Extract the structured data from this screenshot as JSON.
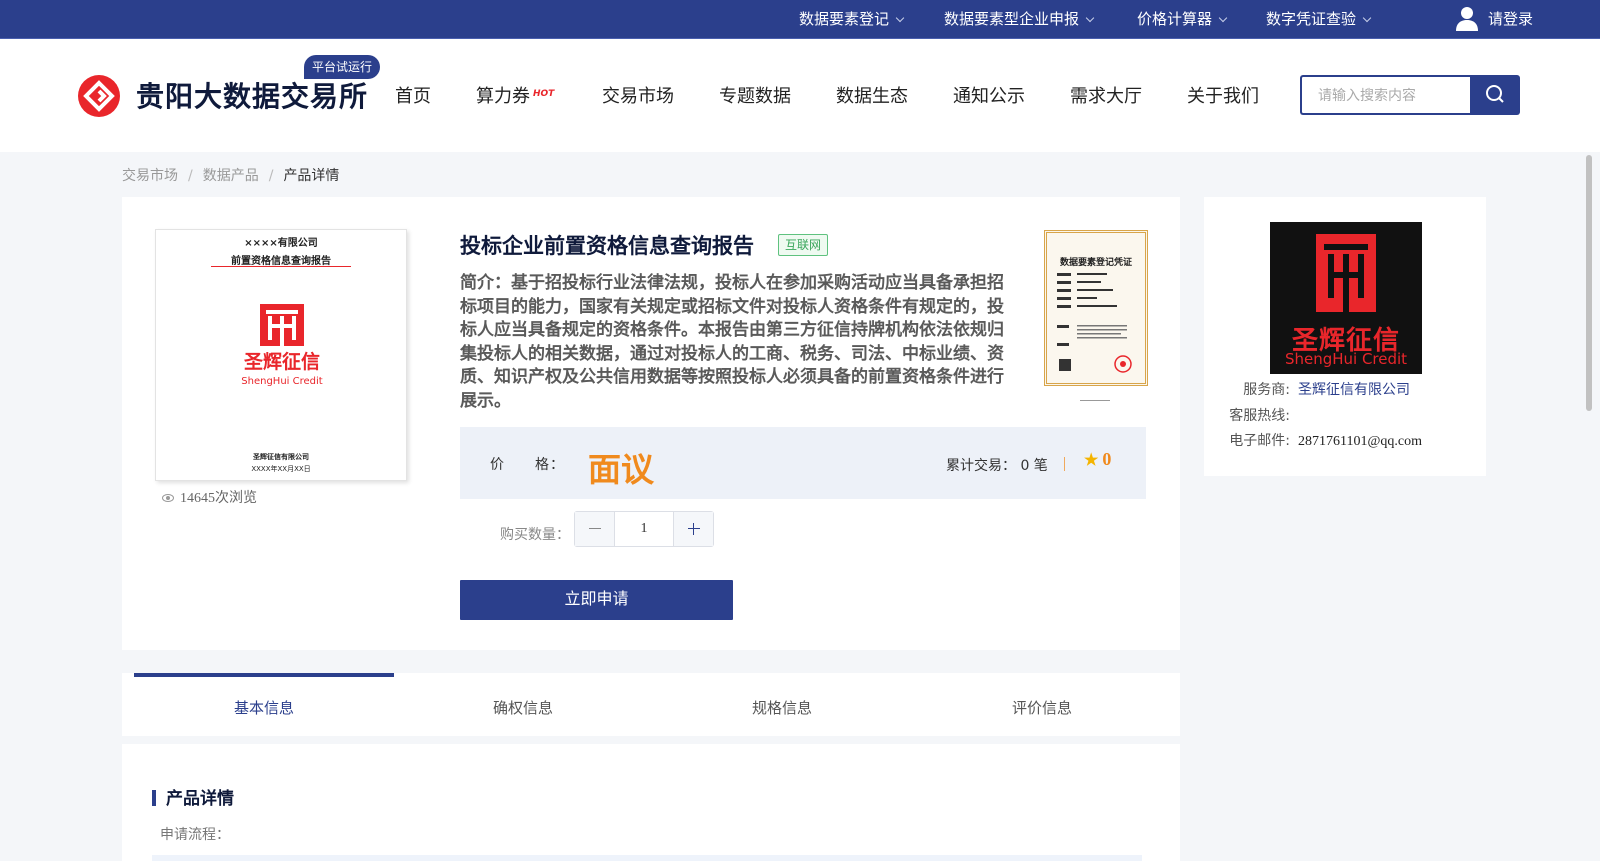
{
  "topbar": {
    "items": [
      "数据要素登记",
      "数据要素型企业申报",
      "价格计算器",
      "数字凭证查验"
    ],
    "login": "请登录"
  },
  "header": {
    "logo_text": "贵阳大数据交易所",
    "trial_badge": "平台试运行",
    "nav": [
      "首页",
      "算力券",
      "交易市场",
      "专题数据",
      "数据生态",
      "通知公示",
      "需求大厅",
      "关于我们"
    ],
    "hot_badge": "HOT",
    "search_placeholder": "请输入搜索内容"
  },
  "breadcrumb": [
    "交易市场",
    "数据产品",
    "产品详情"
  ],
  "product": {
    "cover": {
      "company": "××××有限公司",
      "report_title": "前置资格信息查询报告",
      "brand_cn": "圣辉征信",
      "brand_en": "ShengHui Credit",
      "footer_company": "圣辉征信有限公司",
      "footer_date": "XXXX年XX月XX日"
    },
    "views": "14645次浏览",
    "title": "投标企业前置资格信息查询报告",
    "tag": "互联网",
    "description": "简介：基于招投标行业法律法规，投标人在参加采购活动应当具备承担招标项目的能力，国家有关规定或招标文件对投标人资格条件有规定的，投标人应当具备规定的资格条件。本报告由第三方征信持牌机构依法依规归集投标人的相关数据，通过对投标人的工商、税务、司法、中标业绩、资质、知识产权及公共信用数据等按照投标人必须具备的前置资格条件进行展示。",
    "certificate_title": "数据要素登记凭证",
    "price_label": "价　　格：",
    "price_value": "面议",
    "trade_count": "累计交易： 0 笔",
    "rating": "0",
    "quantity_label": "购买数量：",
    "quantity": "1",
    "apply_button": "立即申请"
  },
  "merchant": {
    "brand_cn": "圣辉征信",
    "brand_en": "ShengHui Credit",
    "provider_label": "服务商:",
    "provider": "圣辉征信有限公司",
    "hotline_label": "客服热线:",
    "hotline": "",
    "email_label": "电子邮件:",
    "email": "2871761101@qq.com"
  },
  "tabs": [
    "基本信息",
    "确权信息",
    "规格信息",
    "评价信息"
  ],
  "details": {
    "title": "产品详情",
    "subtitle": "申请流程："
  },
  "colors": {
    "brand": "#2b3f8c",
    "accent_orange": "#f08a1d",
    "logo_red": "#e9262b",
    "tag_green": "#3aa65b"
  }
}
